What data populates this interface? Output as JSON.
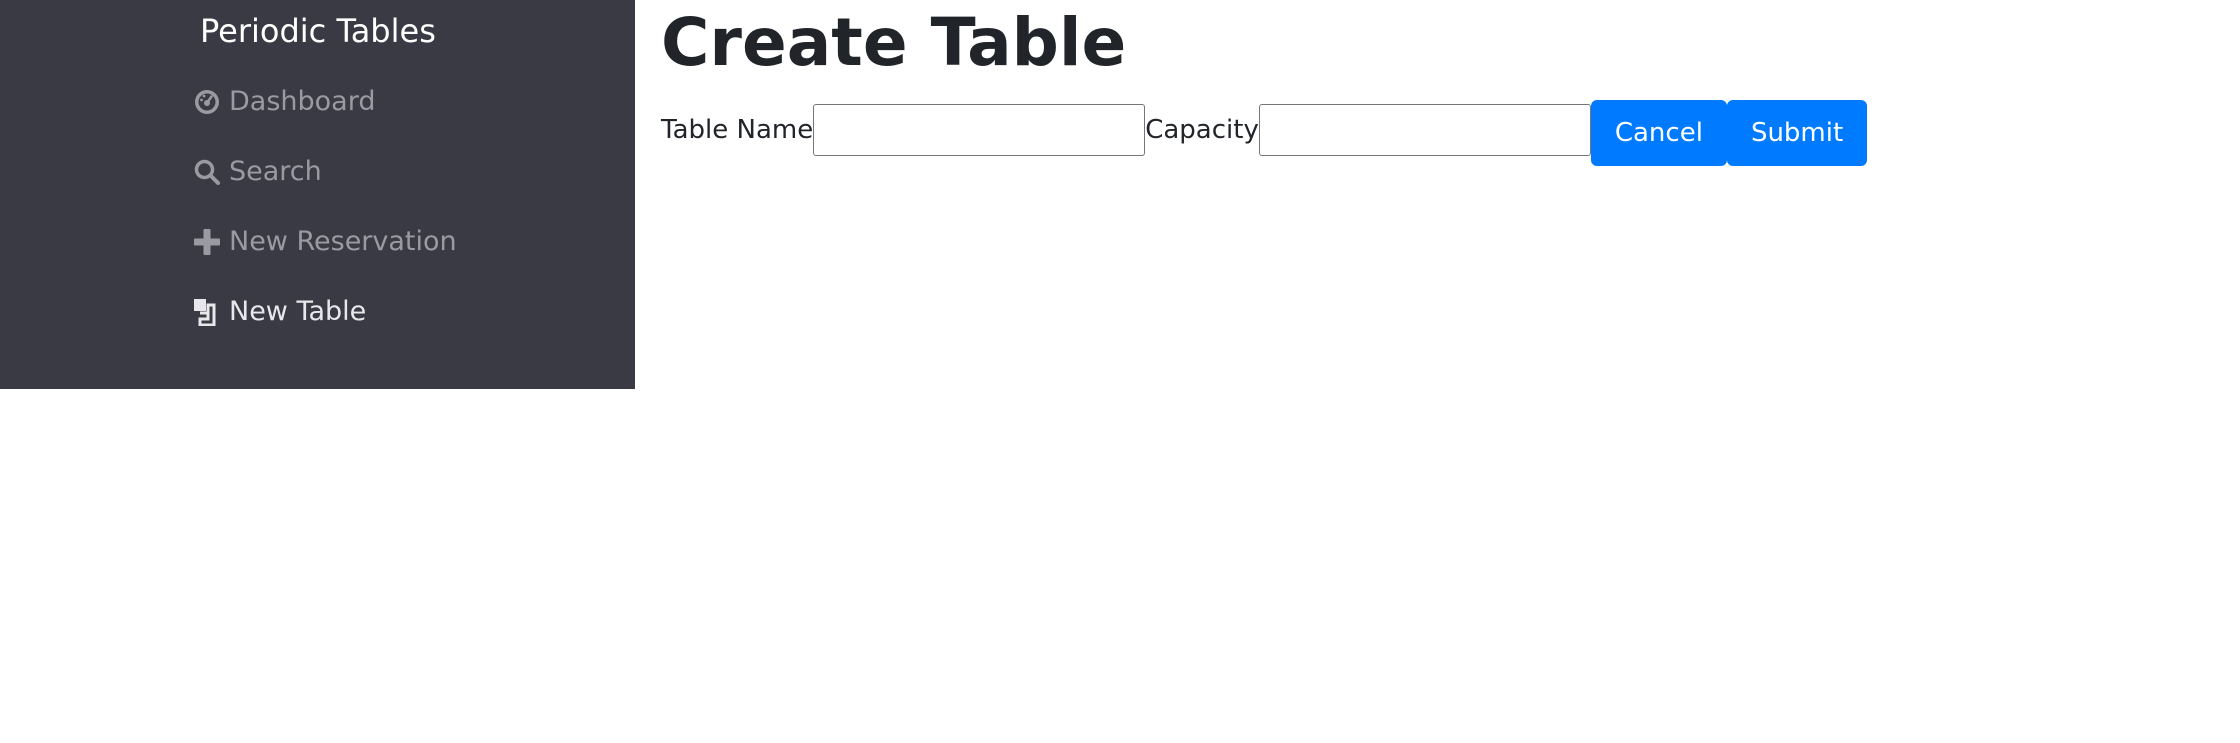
{
  "sidebar": {
    "brand": "Periodic Tables",
    "items": [
      {
        "label": "Dashboard",
        "icon": "dashboard-gauge-icon",
        "active": false
      },
      {
        "label": "Search",
        "icon": "search-icon",
        "active": false
      },
      {
        "label": "New Reservation",
        "icon": "plus-icon",
        "active": false
      },
      {
        "label": "New Table",
        "icon": "layers-icon",
        "active": true
      }
    ]
  },
  "main": {
    "title": "Create Table",
    "form": {
      "table_name_label": "Table Name",
      "table_name_value": "",
      "capacity_label": "Capacity",
      "capacity_value": "",
      "cancel_label": "Cancel",
      "submit_label": "Submit"
    }
  },
  "colors": {
    "sidebar_bg": "#3a3a45",
    "primary_button": "#007bff",
    "nav_text": "#9a9aa2",
    "nav_text_active": "#e8e8ec"
  }
}
